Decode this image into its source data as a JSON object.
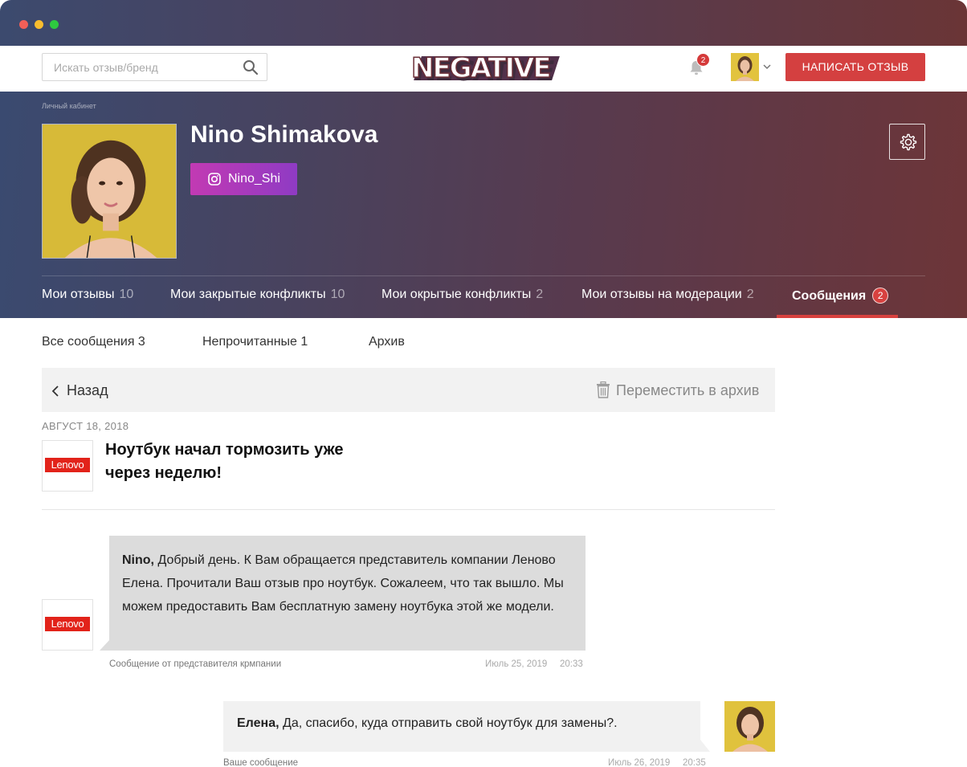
{
  "header": {
    "search_placeholder": "Искать отзыв/бренд",
    "logo_text": "NEGATIVE",
    "notifications_count": "2",
    "write_review_label": "НАПИСАТЬ ОТЗЫВ"
  },
  "profile": {
    "breadcrumb": "Личный кабинет",
    "name": "Nino Shimakova",
    "instagram": "Nino_Shi"
  },
  "tabs": [
    {
      "label": "Мои отзывы",
      "count": "10"
    },
    {
      "label": "Мои закрытые конфликты",
      "count": "10"
    },
    {
      "label": "Мои окрытые конфликты",
      "count": "2"
    },
    {
      "label": "Мои отзывы на модерации",
      "count": "2"
    },
    {
      "label": "Сообщения",
      "count": "2",
      "active": true
    }
  ],
  "subtabs": [
    "Все сообщения 3",
    "Непрочитанные 1",
    "Архив"
  ],
  "toolbar": {
    "back_label": "Назад",
    "archive_label": "Переместить в архив"
  },
  "thread": {
    "date": "АВГУСТ 18, 2018",
    "brand": "Lenovo",
    "title": "Ноутбук начал тормозить уже через неделю!"
  },
  "messages": [
    {
      "sender": "Nino,",
      "text": " Добрый день. К Вам обращается представитель компании Леново Елена. Прочитали Ваш отзыв про ноутбук. Сожалеем, что так вышло. Мы можем предоставить Вам бесплатную замену ноутбука этой же модели.",
      "caption": "Сообщение от представителя крмпании",
      "date": "Июль 25, 2019",
      "time": "20:33"
    },
    {
      "sender": "Елена,",
      "text": " Да, спасибо, куда отправить свой ноутбук для замены?.",
      "caption": "Ваше сообщение",
      "date": "Июль 26, 2019",
      "time": "20:35"
    }
  ],
  "colors": {
    "accent_red": "#d44040",
    "lenovo_red": "#e2231a",
    "instagram_gradient_start": "#c23ab3",
    "instagram_gradient_end": "#8f3bc4"
  }
}
